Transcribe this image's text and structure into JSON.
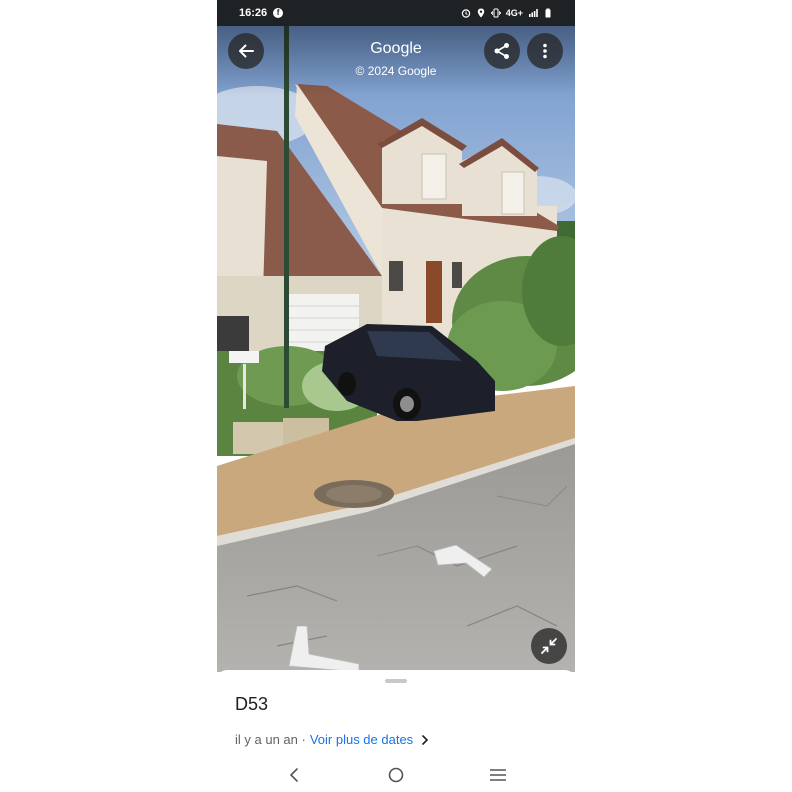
{
  "status_bar": {
    "time": "16:26",
    "app_icon": "facebook-icon",
    "network": "4G+",
    "icons": [
      "alarm-icon",
      "location-icon",
      "vibrate-icon",
      "signal-icon",
      "battery-icon"
    ]
  },
  "street_view": {
    "title": "Google",
    "copyright": "© 2024 Google",
    "buttons": {
      "back": "arrow-left-icon",
      "share": "share-icon",
      "more": "more-vertical-icon",
      "exit_fullscreen": "minimize-icon"
    },
    "nav_arrows": [
      "chevron-arrow-icon",
      "chevron-arrow-icon"
    ]
  },
  "place": {
    "name": "D53",
    "date_text": "il y a un an ·",
    "more_dates_link": "Voir plus de dates"
  },
  "system_nav": {
    "back": "nav-back-icon",
    "home": "nav-home-icon",
    "recents": "nav-recents-icon"
  },
  "colors": {
    "status_bar_bg": "#1f2225",
    "link": "#1a73e8",
    "secondary_text": "#5f6368"
  }
}
